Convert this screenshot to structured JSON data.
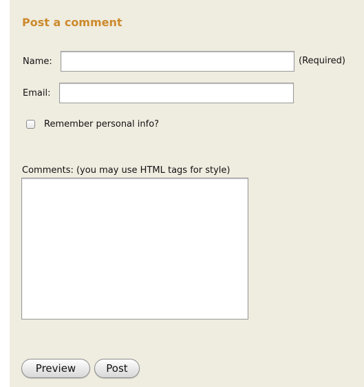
{
  "form": {
    "title": "Post a comment",
    "name_label": "Name:",
    "name_value": "",
    "required_note": "(Required)",
    "email_label": "Email:",
    "email_value": "",
    "remember_label": "Remember personal info?",
    "remember_checked": false,
    "comments_label": "Comments: (you may use HTML tags for style)",
    "comments_value": "",
    "preview_label": "Preview",
    "post_label": "Post"
  },
  "colors": {
    "panel_background": "#efece0",
    "title": "#cc8a2c"
  },
  "icons": {
    "checkbox": "checkbox-unchecked"
  }
}
